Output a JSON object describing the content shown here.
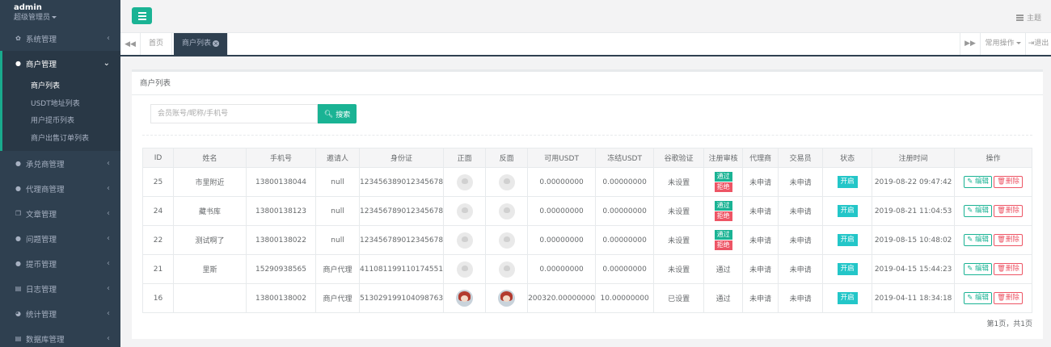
{
  "sidebar": {
    "user": {
      "name": "admin",
      "role": "超级管理员"
    },
    "menu": [
      {
        "label": "系统管理",
        "icon": "gear-icon",
        "glyph": "✿"
      },
      {
        "label": "商户管理",
        "icon": "user-icon",
        "glyph": "●"
      },
      {
        "label": "承兑商管理",
        "icon": "user-icon",
        "glyph": "●"
      },
      {
        "label": "代理商管理",
        "icon": "user-icon",
        "glyph": "●"
      },
      {
        "label": "文章管理",
        "icon": "copy-icon",
        "glyph": "❐"
      },
      {
        "label": "问题管理",
        "icon": "comment-icon",
        "glyph": "●"
      },
      {
        "label": "提币管理",
        "icon": "user-icon",
        "glyph": "●"
      },
      {
        "label": "日志管理",
        "icon": "calendar-icon",
        "glyph": "▤"
      },
      {
        "label": "统计管理",
        "icon": "pie-chart-icon",
        "glyph": "◕"
      },
      {
        "label": "数据库管理",
        "icon": "database-icon",
        "glyph": "▤"
      }
    ],
    "submenu": [
      "商户列表",
      "USDT地址列表",
      "用户提币列表",
      "商户出售订单列表"
    ]
  },
  "topbar": {
    "theme_label": "主题"
  },
  "tabs": {
    "home": "首页",
    "current": "商户列表",
    "common_ops": "常用操作",
    "logout": "退出"
  },
  "panel": {
    "title": "商户列表",
    "search_placeholder": "会员账号/昵称/手机号",
    "search_button": "搜索",
    "pagination": "第1页，共1页"
  },
  "table": {
    "headers": [
      "ID",
      "姓名",
      "手机号",
      "邀请人",
      "身份证",
      "正面",
      "反面",
      "可用USDT",
      "冻结USDT",
      "谷歌验证",
      "注册审核",
      "代理商",
      "交易员",
      "状态",
      "注册时间",
      "操作"
    ],
    "rows": [
      {
        "id": "25",
        "name": "市里附近",
        "phone": "13800138044",
        "inviter": "null",
        "idcard": "123456389012345678",
        "front": "placeholder",
        "back": "placeholder",
        "usdt": "0.00000000",
        "frozen": "0.00000000",
        "google": "未设置",
        "review": "pending",
        "agent": "未申请",
        "trader": "未申请",
        "status": "开启",
        "regtime": "2019-08-22 09:47:42"
      },
      {
        "id": "24",
        "name": "藏书库",
        "phone": "13800138123",
        "inviter": "null",
        "idcard": "123456789012345678",
        "front": "placeholder",
        "back": "placeholder",
        "usdt": "0.00000000",
        "frozen": "0.00000000",
        "google": "未设置",
        "review": "pending",
        "agent": "未申请",
        "trader": "未申请",
        "status": "开启",
        "regtime": "2019-08-21 11:04:53"
      },
      {
        "id": "22",
        "name": "测试啊了",
        "phone": "13800138022",
        "inviter": "null",
        "idcard": "123456789012345678",
        "front": "placeholder",
        "back": "placeholder",
        "usdt": "0.00000000",
        "frozen": "0.00000000",
        "google": "未设置",
        "review": "pending",
        "agent": "未申请",
        "trader": "未申请",
        "status": "开启",
        "regtime": "2019-08-15 10:48:02"
      },
      {
        "id": "21",
        "name": "里斯",
        "phone": "15290938565",
        "inviter": "商户代理",
        "idcard": "411081199110174551",
        "front": "placeholder",
        "back": "placeholder",
        "usdt": "0.00000000",
        "frozen": "0.00000000",
        "google": "未设置",
        "review": "通过",
        "agent": "未申请",
        "trader": "未申请",
        "status": "开启",
        "regtime": "2019-04-15 15:44:23"
      },
      {
        "id": "16",
        "name": "",
        "phone": "13800138002",
        "inviter": "商户代理",
        "idcard": "513029199104098763",
        "front": "photo",
        "back": "photo",
        "usdt": "200320.00000000",
        "frozen": "10.00000000",
        "google": "已设置",
        "review": "通过",
        "agent": "未申请",
        "trader": "未申请",
        "status": "开启",
        "regtime": "2019-04-11 18:34:18"
      }
    ],
    "review_pass_label": "通过",
    "review_reject_label": "拒绝",
    "edit_label": "编辑",
    "delete_label": "删除"
  },
  "colors": {
    "sidebar_bg": "#2f4050",
    "primary": "#1ab394",
    "danger": "#ed5565",
    "info": "#23c6c8"
  }
}
